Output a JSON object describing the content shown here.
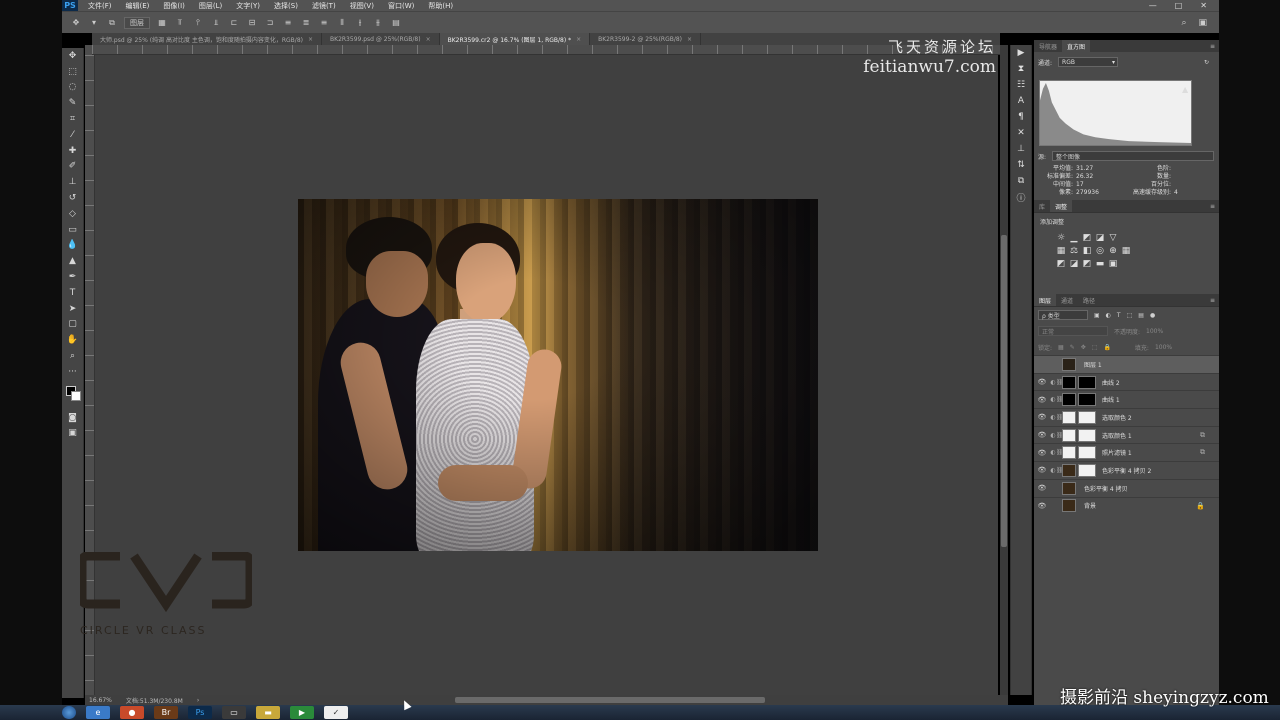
{
  "app": {
    "logo": "PS"
  },
  "menubar": {
    "items": [
      "文件(F)",
      "编辑(E)",
      "图像(I)",
      "图层(L)",
      "文字(Y)",
      "选择(S)",
      "滤镜(T)",
      "视图(V)",
      "窗口(W)",
      "帮助(H)"
    ],
    "window_buttons": [
      "—",
      "□",
      "✕"
    ]
  },
  "options": {
    "mode_select": "图层"
  },
  "tabs": [
    {
      "label": "大师.psd @ 25% (纯调 高对比度 主色调，饱和度随拍摄内容变化，RGB/8)",
      "active": false
    },
    {
      "label": "BK2R3599.psd @ 25%(RGB/8)",
      "active": false
    },
    {
      "label": "BK2R3599.cr2 @ 16.7% (图层 1, RGB/8) *",
      "active": true
    },
    {
      "label": "BK2R3599-2 @ 25%(RGB/8)",
      "active": false
    }
  ],
  "watermark_top": {
    "line1": "飞天资源论坛",
    "line2": "feitianwu7.com"
  },
  "watermark_bottom": "摄影前沿 sheyingzyz.com",
  "logo_overlay": {
    "text": "CIRCLE VR CLASS"
  },
  "status": {
    "zoom": "16.67%",
    "doc": "文档:51.3M/230.8M"
  },
  "histogram_panel": {
    "tabs": [
      "导航器",
      "直方图"
    ],
    "channel_label": "通道:",
    "channel_value": "RGB",
    "source_label": "源:",
    "source_value": "整个图像",
    "stats": [
      {
        "k": "平均值:",
        "v": "31.27",
        "k2": "色阶:",
        "v2": ""
      },
      {
        "k": "标准偏差:",
        "v": "26.32",
        "k2": "数量:",
        "v2": ""
      },
      {
        "k": "中间值:",
        "v": "17",
        "k2": "百分位:",
        "v2": ""
      },
      {
        "k": "像素:",
        "v": "279936",
        "k2": "高速缓存级别:",
        "v2": "4"
      }
    ]
  },
  "adjustments_panel": {
    "tabs": [
      "库",
      "调整"
    ],
    "title": "添加调整"
  },
  "layers_panel": {
    "tabs": [
      "图层",
      "通道",
      "路径"
    ],
    "kind_filter": "ρ 类型",
    "blend_mode": "正常",
    "opacity_label": "不透明度:",
    "opacity_value": "100%",
    "lock_label": "锁定:",
    "fill_label": "填充:",
    "fill_value": "100%",
    "layers": [
      {
        "name": "图层 1",
        "selected": true,
        "visible": false,
        "thumb": "#2a2218",
        "mask": false,
        "badge": ""
      },
      {
        "name": "曲线 2",
        "selected": false,
        "visible": true,
        "thumb": "#000000",
        "mask": true,
        "badge": ""
      },
      {
        "name": "曲线 1",
        "selected": false,
        "visible": true,
        "thumb": "#000000",
        "mask": true,
        "badge": ""
      },
      {
        "name": "选取颜色 2",
        "selected": false,
        "visible": true,
        "thumb": "#f2f2f2",
        "mask": true,
        "badge": ""
      },
      {
        "name": "选取颜色 1",
        "selected": false,
        "visible": true,
        "thumb": "#f2f2f2",
        "mask": true,
        "badge": "⧉"
      },
      {
        "name": "照片滤镜 1",
        "selected": false,
        "visible": true,
        "thumb": "#f2f2f2",
        "mask": true,
        "badge": "⧉"
      },
      {
        "name": "色彩平衡 4 拷贝 2",
        "selected": false,
        "visible": true,
        "thumb": "#3a2a18",
        "mask": true,
        "badge": ""
      },
      {
        "name": "色彩平衡 4 拷贝",
        "selected": false,
        "visible": true,
        "thumb": "#3a2a18",
        "mask": false,
        "badge": ""
      },
      {
        "name": "背景",
        "selected": false,
        "visible": true,
        "thumb": "#3a2a18",
        "mask": false,
        "badge": "🔒"
      }
    ]
  },
  "colors": {
    "ui_bg": "#535353",
    "canvas_bg": "#404040",
    "panel_bg": "#4a4a4a"
  }
}
